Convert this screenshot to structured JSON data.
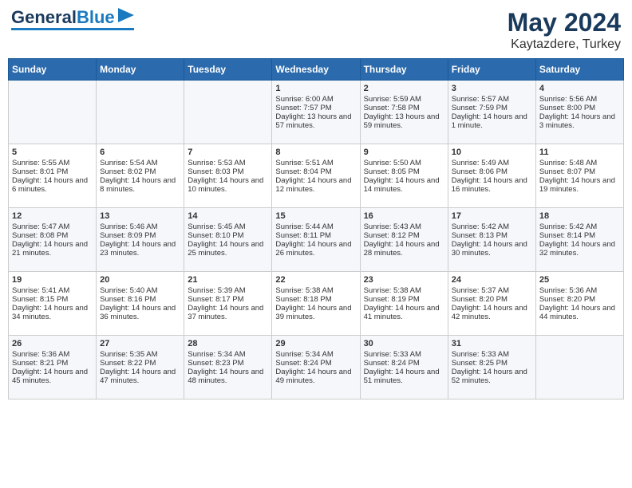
{
  "header": {
    "logo_text1": "General",
    "logo_text2": "Blue",
    "month": "May 2024",
    "location": "Kaytazdere, Turkey"
  },
  "days_of_week": [
    "Sunday",
    "Monday",
    "Tuesday",
    "Wednesday",
    "Thursday",
    "Friday",
    "Saturday"
  ],
  "weeks": [
    [
      {
        "day": "",
        "info": ""
      },
      {
        "day": "",
        "info": ""
      },
      {
        "day": "",
        "info": ""
      },
      {
        "day": "1",
        "info": "Sunrise: 6:00 AM\nSunset: 7:57 PM\nDaylight: 13 hours and 57 minutes."
      },
      {
        "day": "2",
        "info": "Sunrise: 5:59 AM\nSunset: 7:58 PM\nDaylight: 13 hours and 59 minutes."
      },
      {
        "day": "3",
        "info": "Sunrise: 5:57 AM\nSunset: 7:59 PM\nDaylight: 14 hours and 1 minute."
      },
      {
        "day": "4",
        "info": "Sunrise: 5:56 AM\nSunset: 8:00 PM\nDaylight: 14 hours and 3 minutes."
      }
    ],
    [
      {
        "day": "5",
        "info": "Sunrise: 5:55 AM\nSunset: 8:01 PM\nDaylight: 14 hours and 6 minutes."
      },
      {
        "day": "6",
        "info": "Sunrise: 5:54 AM\nSunset: 8:02 PM\nDaylight: 14 hours and 8 minutes."
      },
      {
        "day": "7",
        "info": "Sunrise: 5:53 AM\nSunset: 8:03 PM\nDaylight: 14 hours and 10 minutes."
      },
      {
        "day": "8",
        "info": "Sunrise: 5:51 AM\nSunset: 8:04 PM\nDaylight: 14 hours and 12 minutes."
      },
      {
        "day": "9",
        "info": "Sunrise: 5:50 AM\nSunset: 8:05 PM\nDaylight: 14 hours and 14 minutes."
      },
      {
        "day": "10",
        "info": "Sunrise: 5:49 AM\nSunset: 8:06 PM\nDaylight: 14 hours and 16 minutes."
      },
      {
        "day": "11",
        "info": "Sunrise: 5:48 AM\nSunset: 8:07 PM\nDaylight: 14 hours and 19 minutes."
      }
    ],
    [
      {
        "day": "12",
        "info": "Sunrise: 5:47 AM\nSunset: 8:08 PM\nDaylight: 14 hours and 21 minutes."
      },
      {
        "day": "13",
        "info": "Sunrise: 5:46 AM\nSunset: 8:09 PM\nDaylight: 14 hours and 23 minutes."
      },
      {
        "day": "14",
        "info": "Sunrise: 5:45 AM\nSunset: 8:10 PM\nDaylight: 14 hours and 25 minutes."
      },
      {
        "day": "15",
        "info": "Sunrise: 5:44 AM\nSunset: 8:11 PM\nDaylight: 14 hours and 26 minutes."
      },
      {
        "day": "16",
        "info": "Sunrise: 5:43 AM\nSunset: 8:12 PM\nDaylight: 14 hours and 28 minutes."
      },
      {
        "day": "17",
        "info": "Sunrise: 5:42 AM\nSunset: 8:13 PM\nDaylight: 14 hours and 30 minutes."
      },
      {
        "day": "18",
        "info": "Sunrise: 5:42 AM\nSunset: 8:14 PM\nDaylight: 14 hours and 32 minutes."
      }
    ],
    [
      {
        "day": "19",
        "info": "Sunrise: 5:41 AM\nSunset: 8:15 PM\nDaylight: 14 hours and 34 minutes."
      },
      {
        "day": "20",
        "info": "Sunrise: 5:40 AM\nSunset: 8:16 PM\nDaylight: 14 hours and 36 minutes."
      },
      {
        "day": "21",
        "info": "Sunrise: 5:39 AM\nSunset: 8:17 PM\nDaylight: 14 hours and 37 minutes."
      },
      {
        "day": "22",
        "info": "Sunrise: 5:38 AM\nSunset: 8:18 PM\nDaylight: 14 hours and 39 minutes."
      },
      {
        "day": "23",
        "info": "Sunrise: 5:38 AM\nSunset: 8:19 PM\nDaylight: 14 hours and 41 minutes."
      },
      {
        "day": "24",
        "info": "Sunrise: 5:37 AM\nSunset: 8:20 PM\nDaylight: 14 hours and 42 minutes."
      },
      {
        "day": "25",
        "info": "Sunrise: 5:36 AM\nSunset: 8:20 PM\nDaylight: 14 hours and 44 minutes."
      }
    ],
    [
      {
        "day": "26",
        "info": "Sunrise: 5:36 AM\nSunset: 8:21 PM\nDaylight: 14 hours and 45 minutes."
      },
      {
        "day": "27",
        "info": "Sunrise: 5:35 AM\nSunset: 8:22 PM\nDaylight: 14 hours and 47 minutes."
      },
      {
        "day": "28",
        "info": "Sunrise: 5:34 AM\nSunset: 8:23 PM\nDaylight: 14 hours and 48 minutes."
      },
      {
        "day": "29",
        "info": "Sunrise: 5:34 AM\nSunset: 8:24 PM\nDaylight: 14 hours and 49 minutes."
      },
      {
        "day": "30",
        "info": "Sunrise: 5:33 AM\nSunset: 8:24 PM\nDaylight: 14 hours and 51 minutes."
      },
      {
        "day": "31",
        "info": "Sunrise: 5:33 AM\nSunset: 8:25 PM\nDaylight: 14 hours and 52 minutes."
      },
      {
        "day": "",
        "info": ""
      }
    ]
  ]
}
